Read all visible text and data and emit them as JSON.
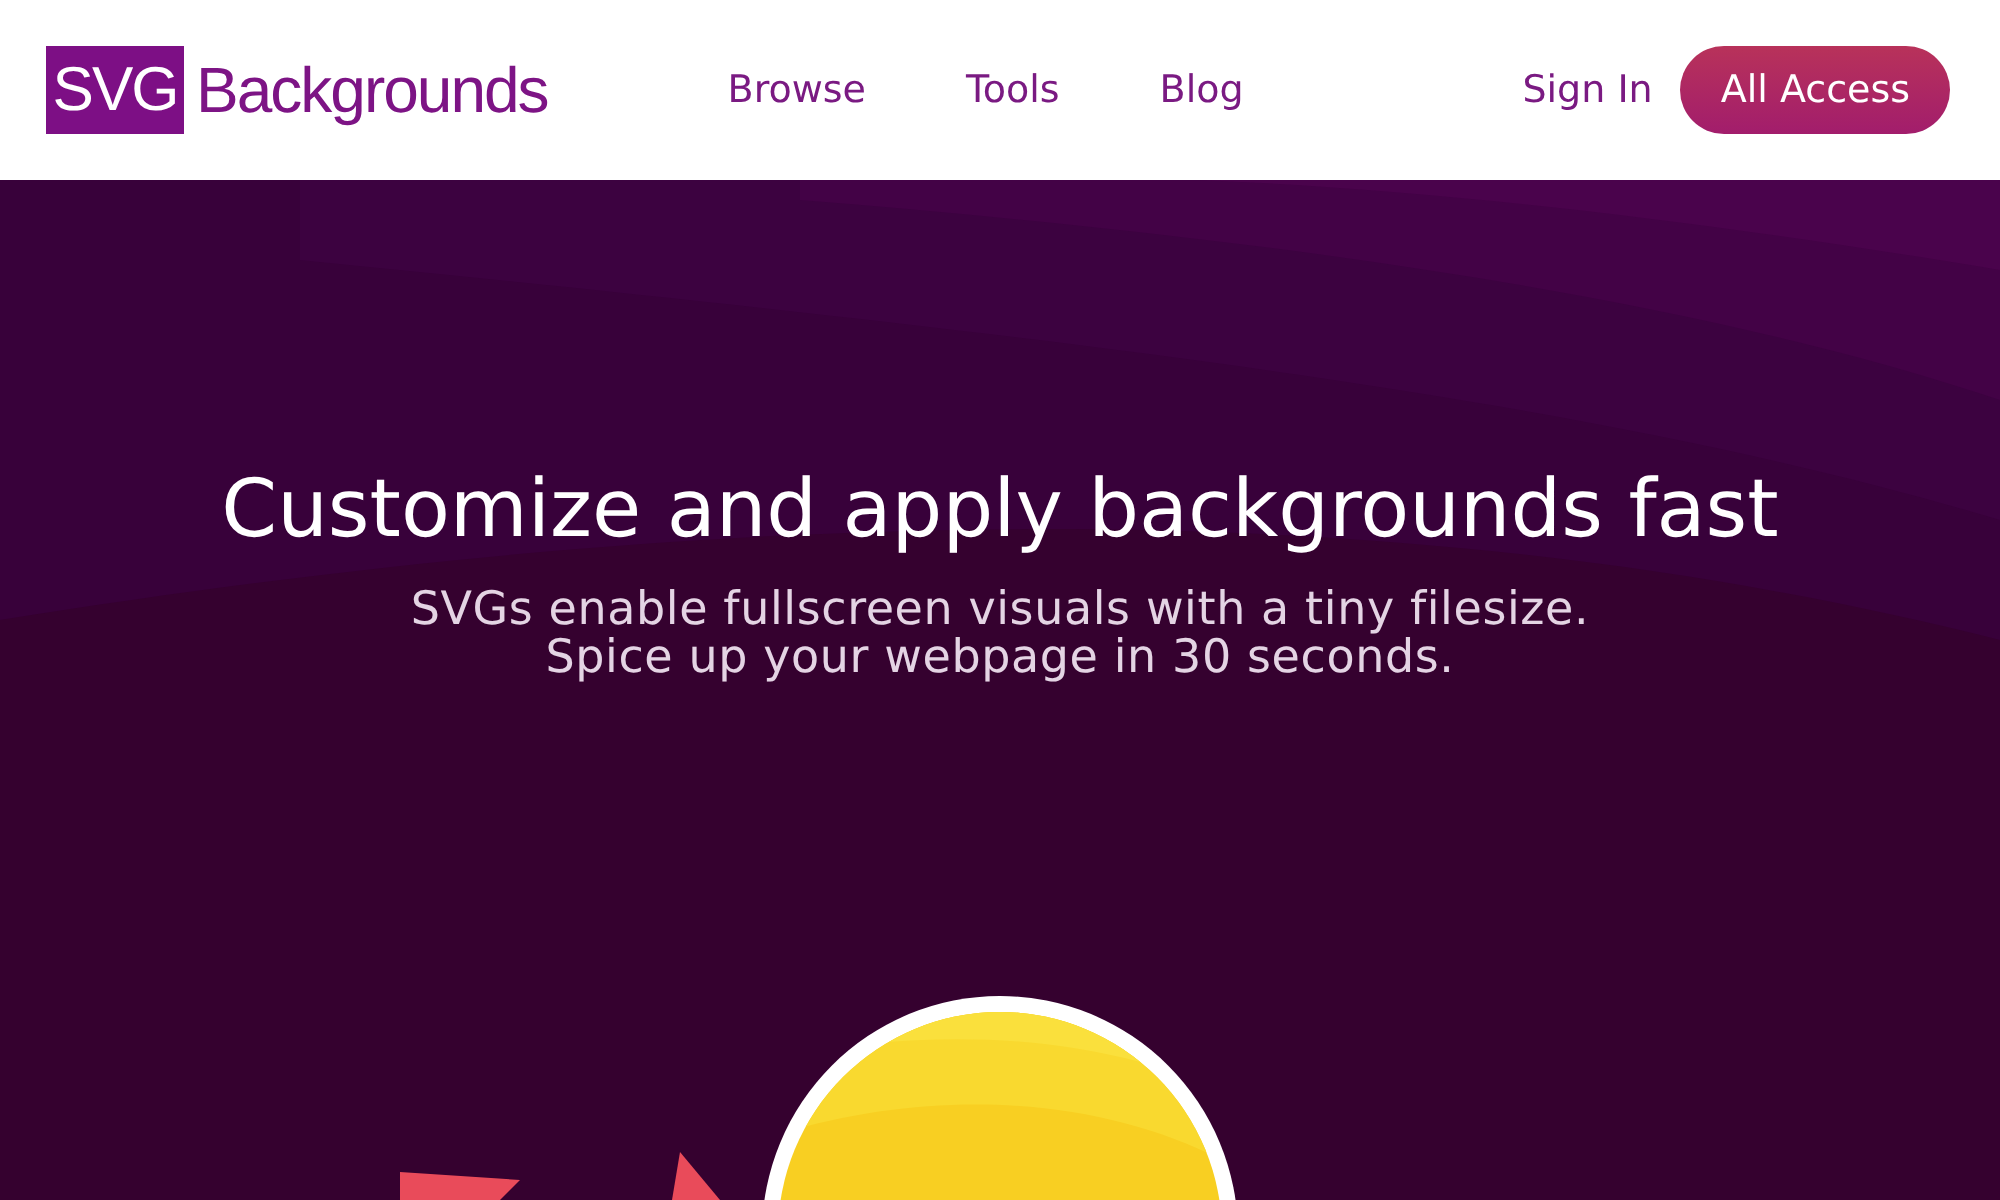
{
  "header": {
    "logo": {
      "mark": "SVG",
      "wordmark": "Backgrounds"
    },
    "nav": [
      {
        "label": "Browse"
      },
      {
        "label": "Tools"
      },
      {
        "label": "Blog"
      }
    ],
    "sign_in": "Sign In",
    "cta": "All Access"
  },
  "hero": {
    "title": "Customize and apply backgrounds fast",
    "subtitle_lines": [
      "SVGs enable fullscreen visuals with a tiny filesize.",
      "Spice up your webpage in 30 seconds."
    ]
  }
}
